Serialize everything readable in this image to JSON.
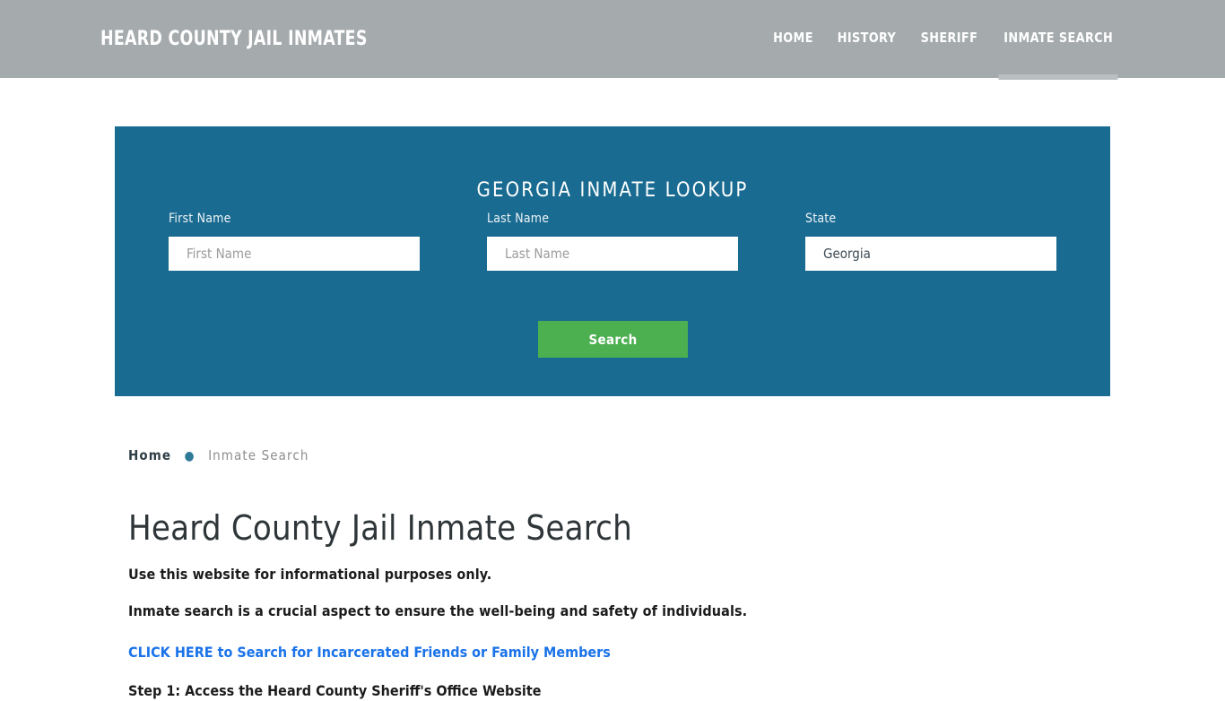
{
  "header": {
    "brand": "HEARD COUNTY JAIL INMATES",
    "nav": [
      {
        "label": "HOME",
        "active": false
      },
      {
        "label": "HISTORY",
        "active": false
      },
      {
        "label": "SHERIFF",
        "active": false
      },
      {
        "label": "INMATE SEARCH",
        "active": true
      }
    ]
  },
  "lookup": {
    "title": "GEORGIA INMATE LOOKUP",
    "first_name": {
      "label": "First Name",
      "placeholder": "First Name",
      "value": ""
    },
    "last_name": {
      "label": "Last Name",
      "placeholder": "Last Name",
      "value": ""
    },
    "state": {
      "label": "State",
      "value": "Georgia",
      "options": [
        "Georgia"
      ]
    },
    "search_button": "Search",
    "panel_color": "#1a6b91",
    "button_color": "#4caf50"
  },
  "breadcrumb": {
    "home": "Home",
    "separator": "●",
    "current": "Inmate Search"
  },
  "content": {
    "page_title": "Heard County Jail Inmate Search",
    "paragraph_1": "Use this website for informational purposes only.",
    "paragraph_2": "Inmate search is a crucial aspect to ensure the well-being and safety of individuals.",
    "link_text": "CLICK HERE to Search for Incarcerated Friends or Family Members",
    "step_1": "Step 1: Access the Heard County Sheriff's Office Website"
  }
}
